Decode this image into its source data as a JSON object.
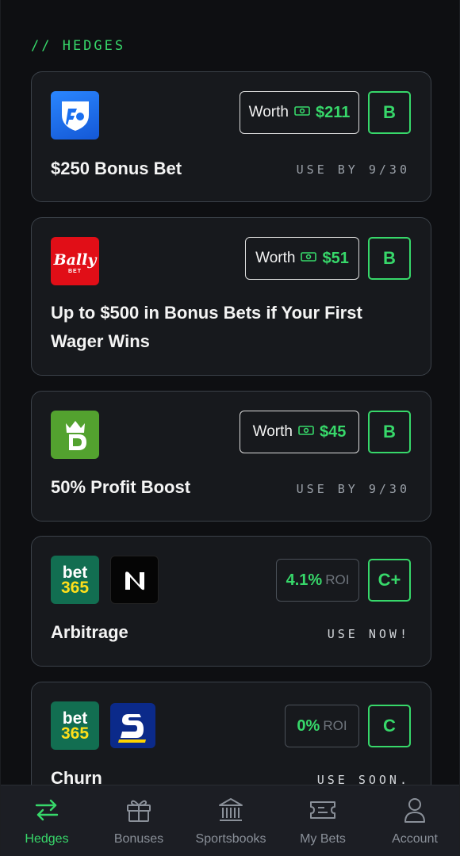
{
  "section_title": "// HEDGES",
  "cards": [
    {
      "book": "FanDuel",
      "worth_label": "Worth",
      "worth_value": "$211",
      "grade": "B",
      "title": "$250 Bonus Bet",
      "status": "USE BY 9/30"
    },
    {
      "book": "Bally Bet",
      "logo_text": "Bally",
      "logo_subtext": "BET",
      "worth_label": "Worth",
      "worth_value": "$51",
      "grade": "B",
      "title": "Up to $500 in Bonus Bets if Your First Wager Wins"
    },
    {
      "book": "DraftKings",
      "worth_label": "Worth",
      "worth_value": "$45",
      "grade": "B",
      "title": "50% Profit Boost",
      "status": "USE BY 9/30"
    },
    {
      "books": [
        "bet365",
        "Novig"
      ],
      "logo_text_1": "bet",
      "logo_text_2": "365",
      "roi_value": "4.1%",
      "roi_label": "ROI",
      "grade": "C+",
      "title": "Arbitrage",
      "status": "USE NOW!"
    },
    {
      "books": [
        "bet365",
        "Sporttrade"
      ],
      "logo_text_1": "bet",
      "logo_text_2": "365",
      "roi_value": "0%",
      "roi_label": "ROI",
      "grade": "C",
      "title": "Churn",
      "status": "USE SOON."
    }
  ],
  "nav": [
    {
      "label": "Hedges",
      "icon": "swap-arrows-icon",
      "active": true
    },
    {
      "label": "Bonuses",
      "icon": "gift-icon"
    },
    {
      "label": "Sportsbooks",
      "icon": "bank-icon"
    },
    {
      "label": "My Bets",
      "icon": "ticket-icon"
    },
    {
      "label": "Account",
      "icon": "user-icon"
    }
  ],
  "colors": {
    "accent": "#37d86a",
    "background": "#0e0f12",
    "card": "#17191d",
    "card_border": "#3b4149",
    "fanduel_blue": "#1a6ff0",
    "bally_red": "#e10e17",
    "draftkings_green": "#53a22f",
    "bet365_green": "#126e51",
    "bet365_yellow": "#ffdf1b"
  }
}
